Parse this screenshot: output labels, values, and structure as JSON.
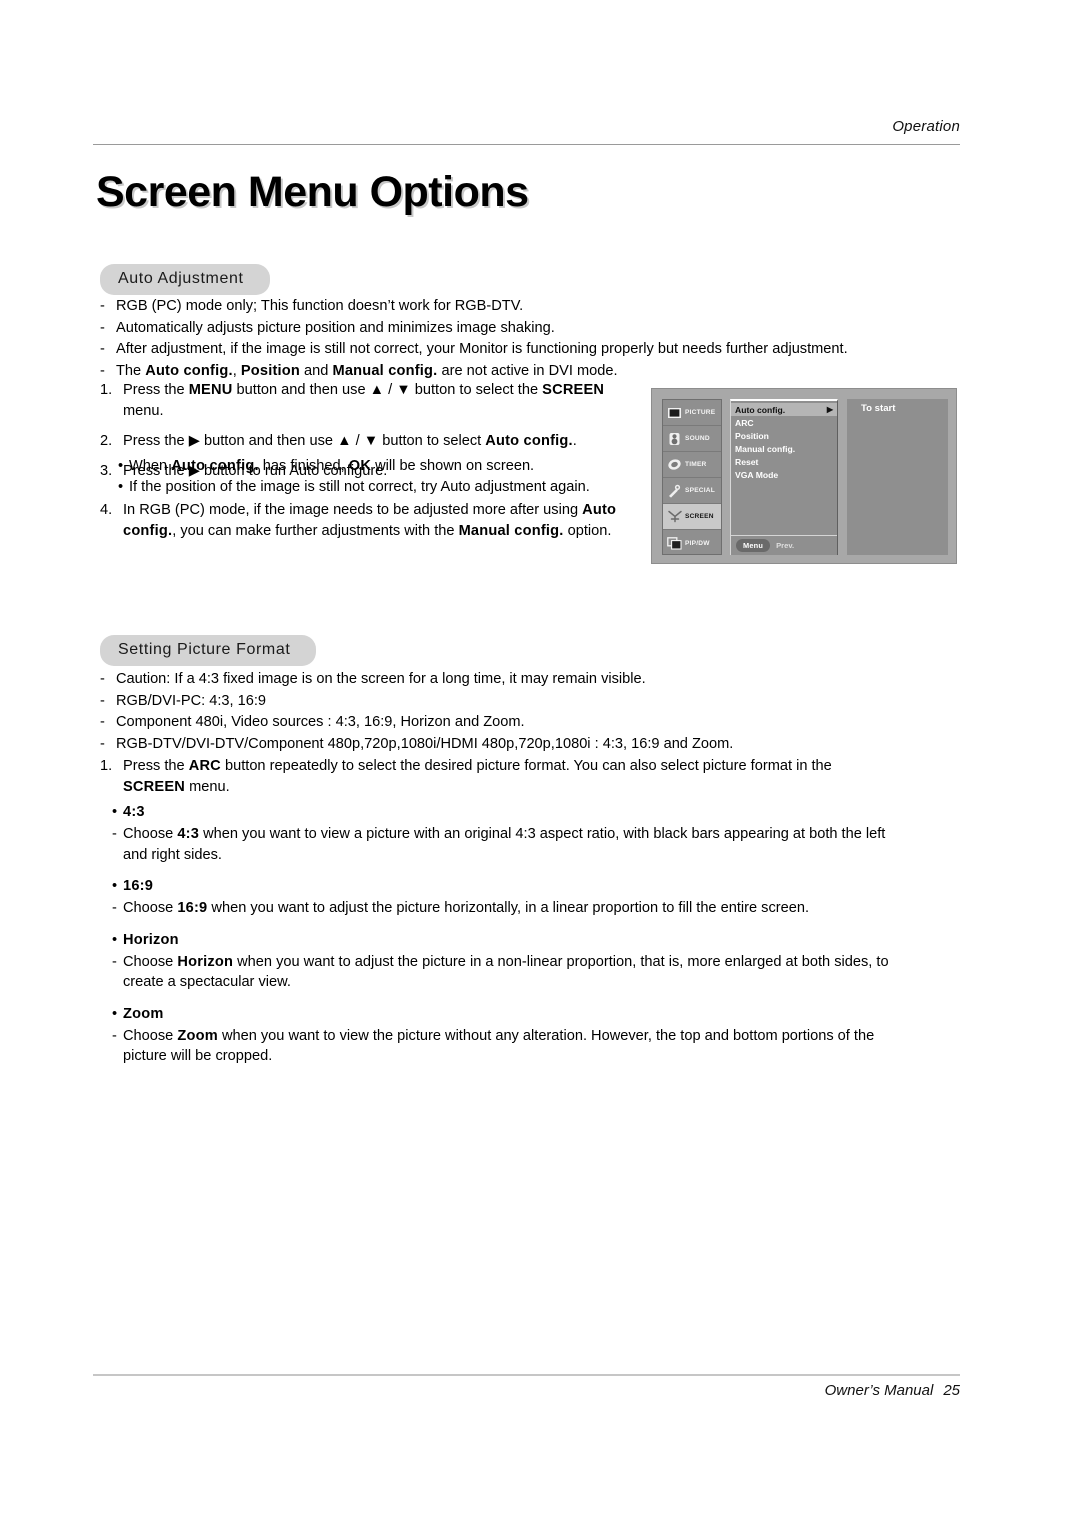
{
  "header": {
    "running_head": "Operation"
  },
  "title": "Screen Menu Options",
  "sections": [
    {
      "heading": "Auto Adjustment",
      "dash_items": [
        {
          "parts": [
            {
              "t": "RGB (PC) mode only; This function doesn’t work for RGB-DTV.",
              "b": false
            }
          ]
        },
        {
          "parts": [
            {
              "t": "Automatically adjusts picture position and minimizes image shaking.",
              "b": false
            }
          ]
        },
        {
          "parts": [
            {
              "t": "After adjustment, if the image is still not correct, your Monitor is functioning properly but needs further adjustment.",
              "b": false
            }
          ]
        },
        {
          "parts": [
            {
              "t": "The ",
              "b": false
            },
            {
              "t": "Auto config.",
              "b": true
            },
            {
              "t": ", ",
              "b": false
            },
            {
              "t": "Position",
              "b": true
            },
            {
              "t": " and ",
              "b": false
            },
            {
              "t": "Manual config.",
              "b": true
            },
            {
              "t": " are not active in DVI mode.",
              "b": false
            }
          ]
        }
      ],
      "steps": [
        {
          "num": "1.",
          "parts": [
            {
              "t": "Press the ",
              "b": false
            },
            {
              "t": "MENU",
              "b": true
            },
            {
              "t": " button and then use ",
              "b": false
            },
            {
              "t": "▲",
              "b": false
            },
            {
              "t": " / ",
              "b": false
            },
            {
              "t": "▼",
              "b": false
            },
            {
              "t": "  button to select the ",
              "b": false
            },
            {
              "t": "SCREEN",
              "b": true
            },
            {
              "t": " menu.",
              "b": false
            }
          ]
        },
        {
          "num": "2.",
          "parts": [
            {
              "t": "Press the ",
              "b": false
            },
            {
              "t": "▶",
              "b": false
            },
            {
              "t": " button and then use ",
              "b": false
            },
            {
              "t": "▲",
              "b": false
            },
            {
              "t": " / ",
              "b": false
            },
            {
              "t": "▼",
              "b": false
            },
            {
              "t": "  button to select ",
              "b": false
            },
            {
              "t": "Auto config.",
              "b": true
            },
            {
              "t": ".",
              "b": false
            }
          ]
        },
        {
          "num": "3.",
          "parts": [
            {
              "t": "Press the ",
              "b": false
            },
            {
              "t": "▶",
              "b": false
            },
            {
              "t": " button to run Auto configure.",
              "b": false
            }
          ]
        }
      ],
      "sub_bullets": [
        {
          "parts": [
            {
              "t": "When ",
              "b": false
            },
            {
              "t": "Auto config.",
              "b": true
            },
            {
              "t": " has finished, ",
              "b": false
            },
            {
              "t": "OK",
              "b": true
            },
            {
              "t": " will be shown on screen.",
              "b": false
            }
          ]
        },
        {
          "parts": [
            {
              "t": "If the position of the image is still not correct, try Auto adjustment again.",
              "b": false
            }
          ]
        }
      ],
      "step4": {
        "num": "4.",
        "parts": [
          {
            "t": "In RGB (PC) mode, if the image needs to be adjusted more after using ",
            "b": false
          },
          {
            "t": "Auto config.",
            "b": true
          },
          {
            "t": ", you can make further adjustments with the ",
            "b": false
          },
          {
            "t": "Manual config.",
            "b": true
          },
          {
            "t": " option.",
            "b": false
          }
        ]
      }
    },
    {
      "heading": "Setting Picture Format",
      "dash_items": [
        {
          "parts": [
            {
              "t": "Caution: If a 4:3 fixed image is on the screen for a long time, it may remain visible.",
              "b": false
            }
          ]
        },
        {
          "parts": [
            {
              "t": "RGB/DVI-PC: 4:3, 16:9",
              "b": false
            }
          ]
        },
        {
          "parts": [
            {
              "t": "Component 480i, Video sources : 4:3, 16:9, Horizon and Zoom.",
              "b": false
            }
          ]
        },
        {
          "parts": [
            {
              "t": "RGB-DTV/DVI-DTV/Component 480p,720p,1080i/HDMI 480p,720p,1080i : 4:3, 16:9 and Zoom.",
              "b": false
            }
          ]
        }
      ],
      "steps": [
        {
          "num": "1.",
          "parts": [
            {
              "t": "Press the ",
              "b": false
            },
            {
              "t": "ARC",
              "b": true
            },
            {
              "t": " button repeatedly to select the desired picture format. You can also select picture format in the ",
              "b": false
            },
            {
              "t": "SCREEN",
              "b": true
            },
            {
              "t": " menu.",
              "b": false
            }
          ]
        }
      ],
      "formats": [
        {
          "name": "4:3",
          "parts": [
            {
              "t": "Choose ",
              "b": false
            },
            {
              "t": "4:3",
              "b": true
            },
            {
              "t": " when you want to view a picture with an original 4:3 aspect ratio, with black bars appearing at both the left and right sides.",
              "b": false
            }
          ]
        },
        {
          "name": "16:9",
          "parts": [
            {
              "t": "Choose ",
              "b": false
            },
            {
              "t": "16:9",
              "b": true
            },
            {
              "t": " when you want to adjust the picture horizontally, in a linear proportion to fill the entire screen.",
              "b": false
            }
          ]
        },
        {
          "name": "Horizon",
          "parts": [
            {
              "t": "Choose ",
              "b": false
            },
            {
              "t": "Horizon",
              "b": true
            },
            {
              "t": " when you want to adjust the picture in a non-linear proportion, that is, more enlarged at both sides, to create a spectacular view.",
              "b": false
            }
          ]
        },
        {
          "name": "Zoom",
          "parts": [
            {
              "t": "Choose ",
              "b": false
            },
            {
              "t": "Zoom",
              "b": true
            },
            {
              "t": " when you want to view the picture without any alteration. However, the top and bottom portions of the picture will be cropped.",
              "b": false
            }
          ]
        }
      ]
    }
  ],
  "osd": {
    "sidebar": [
      {
        "label": "PICTURE",
        "icon": "picture-icon",
        "active": false
      },
      {
        "label": "SOUND",
        "icon": "speaker-icon",
        "active": false
      },
      {
        "label": "TIMER",
        "icon": "clock-icon",
        "active": false
      },
      {
        "label": "SPECIAL",
        "icon": "wrench-icon",
        "active": false
      },
      {
        "label": "SCREEN",
        "icon": "screen-adjust-icon",
        "active": true
      },
      {
        "label": "PIP/DW",
        "icon": "pip-icon",
        "active": false
      }
    ],
    "menu_items": [
      {
        "label": "Auto config.",
        "selected": true,
        "cursor": "▶"
      },
      {
        "label": "ARC",
        "selected": false,
        "cursor": ""
      },
      {
        "label": "Position",
        "selected": false,
        "cursor": ""
      },
      {
        "label": "Manual config.",
        "selected": false,
        "cursor": ""
      },
      {
        "label": "Reset",
        "selected": false,
        "cursor": ""
      },
      {
        "label": "VGA Mode",
        "selected": false,
        "cursor": ""
      }
    ],
    "detail_text": "To start",
    "menu_button": "Menu",
    "prev_label": "Prev."
  },
  "footer": {
    "manual_label": "Owner’s Manual",
    "page_number": "25"
  },
  "colors": {
    "pill_bg": "#d4d4d4",
    "rule": "#9a9a9a",
    "osd_bg": "#a8a8a8",
    "osd_panel": "#8f8f8f",
    "osd_highlight": "#b5b5b5"
  }
}
